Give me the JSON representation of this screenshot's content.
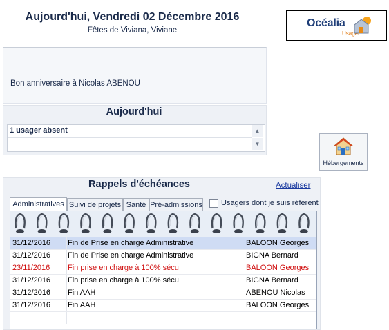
{
  "header": {
    "title": "Aujourd'hui, Vendredi 02 Décembre 2016",
    "subtitle": "Fêtes de Viviana, Viviane"
  },
  "logo": {
    "brand": "Océalia",
    "sub": "Usager"
  },
  "birthday": {
    "text": "Bon anniversaire à Nicolas ABENOU"
  },
  "today": {
    "title": "Aujourd'hui",
    "absent": "1 usager absent"
  },
  "hebergements": {
    "label": "Hébergements",
    "icon": "house-icon"
  },
  "rappels": {
    "title": "Rappels d'échéances",
    "refresh_label": "Actualiser",
    "tabs": [
      "Administratives",
      "Suivi de projets",
      "Santé",
      "Pré-admissions"
    ],
    "checkbox_label": "Usagers dont je suis référent",
    "checkbox_checked": false,
    "rows": [
      {
        "date": "31/12/2016",
        "label": "Fin de Prise en charge Administrative",
        "person": "BALOON Georges",
        "color": "#000000",
        "selected": true
      },
      {
        "date": "31/12/2016",
        "label": "Fin de Prise en charge Administrative",
        "person": "BIGNA Bernard",
        "color": "#000000",
        "selected": false
      },
      {
        "date": "23/11/2016",
        "label": "Fin prise en charge à 100% sécu",
        "person": "BALOON Georges",
        "color": "#d01010",
        "selected": false
      },
      {
        "date": "31/12/2016",
        "label": "Fin prise en charge à 100% sécu",
        "person": "BIGNA Bernard",
        "color": "#000000",
        "selected": false
      },
      {
        "date": "31/12/2016",
        "label": "Fin AAH",
        "person": "ABENOU Nicolas",
        "color": "#000000",
        "selected": false
      },
      {
        "date": "31/12/2016",
        "label": "Fin AAH",
        "person": "BALOON Georges",
        "color": "#000000",
        "selected": false
      }
    ]
  },
  "colors": {
    "accent": "#1a2a4a",
    "link": "#1a3aa0",
    "alert": "#d01010",
    "selected_row": "#cfdcf4"
  }
}
